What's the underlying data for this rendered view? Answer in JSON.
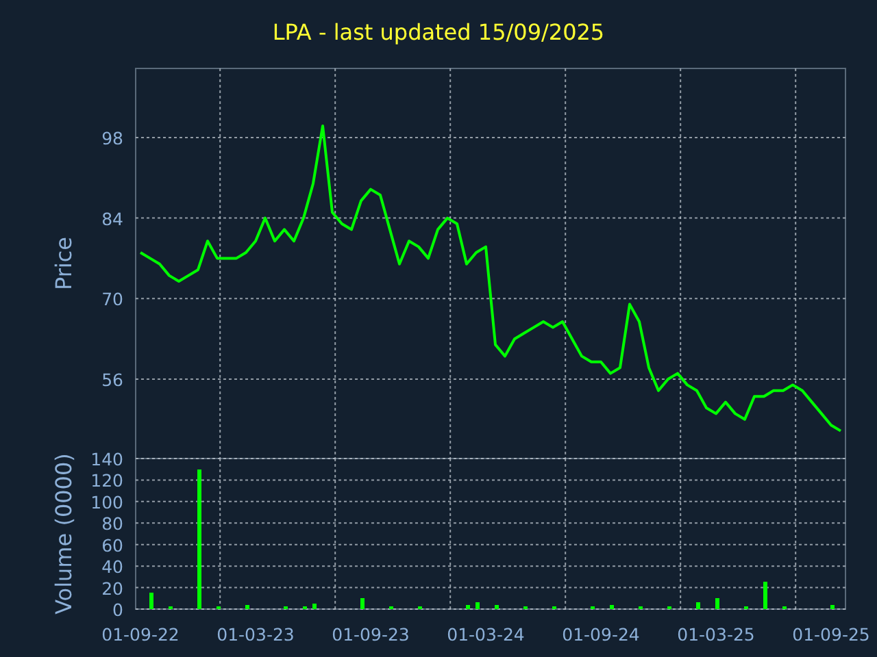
{
  "title": "LPA - last updated 15/09/2025",
  "price_chart": {
    "chart_data": {
      "type": "line",
      "grid": true,
      "ylabel": "Price",
      "ylim": [
        42.2,
        110
      ],
      "yticks": [
        56,
        70,
        84,
        98
      ],
      "values": [
        78,
        77,
        76,
        74,
        73,
        74,
        75,
        80,
        77,
        77,
        77,
        78,
        80,
        84,
        80,
        82,
        80,
        84,
        90,
        100,
        85,
        83,
        82,
        87,
        89,
        88,
        82,
        76,
        80,
        79,
        77,
        82,
        84,
        83,
        76,
        78,
        79,
        62,
        60,
        63,
        64,
        65,
        66,
        65,
        66,
        63,
        60,
        59,
        59,
        57,
        58,
        69,
        66,
        58,
        54,
        56,
        57,
        55,
        54,
        51,
        50,
        52,
        50,
        49,
        53,
        53,
        54,
        54,
        55,
        54,
        52,
        50,
        48,
        47
      ]
    }
  },
  "volume_chart": {
    "chart_data": {
      "type": "bar",
      "grid": true,
      "ylabel": "Volume (0000)",
      "ylim": [
        0,
        140
      ],
      "yticks": [
        0,
        20,
        40,
        60,
        80,
        100,
        120,
        140
      ],
      "categories": [
        "01-09-22",
        null,
        null,
        null,
        null,
        null,
        null,
        null,
        null,
        null,
        null,
        null,
        "01-03-23",
        null,
        null,
        null,
        null,
        null,
        null,
        null,
        null,
        null,
        null,
        null,
        "01-09-23",
        null,
        null,
        null,
        null,
        null,
        null,
        null,
        null,
        null,
        null,
        null,
        "01-03-24",
        null,
        null,
        null,
        null,
        null,
        null,
        null,
        null,
        null,
        null,
        null,
        "01-09-24",
        null,
        null,
        null,
        null,
        null,
        null,
        null,
        null,
        null,
        null,
        null,
        "01-03-25",
        null,
        null,
        null,
        null,
        null,
        null,
        null,
        null,
        null,
        null,
        null,
        "01-09-25",
        null
      ],
      "values": [
        0,
        15,
        0,
        3,
        0,
        0,
        130,
        0,
        3,
        0,
        0,
        4,
        0,
        0,
        0,
        2,
        0,
        3,
        5,
        0,
        0,
        0,
        0,
        10,
        0,
        0,
        3,
        0,
        0,
        2,
        0,
        0,
        0,
        0,
        4,
        6,
        0,
        4,
        0,
        0,
        2,
        0,
        0,
        3,
        0,
        0,
        0,
        2,
        0,
        4,
        0,
        0,
        3,
        0,
        0,
        2,
        0,
        0,
        6,
        0,
        10,
        0,
        0,
        3,
        0,
        25,
        0,
        3,
        0,
        0,
        0,
        0,
        4,
        0
      ]
    }
  }
}
